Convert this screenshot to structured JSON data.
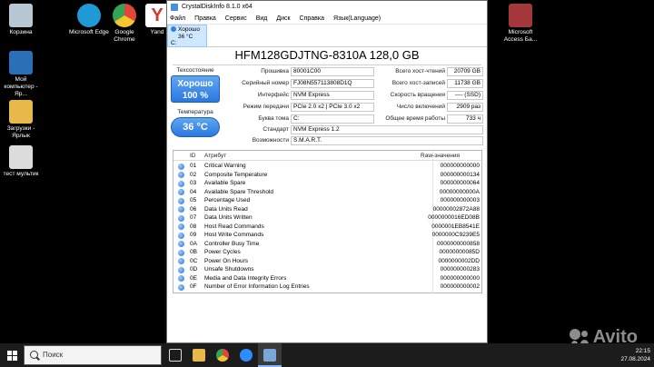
{
  "desktop": {
    "icons": [
      {
        "label": "Корзина",
        "color": "#b9c6d4"
      },
      {
        "label": "Microsoft Edge",
        "color": "#1f9ad6"
      },
      {
        "label": "Google Chrome",
        "color": "#e2463b"
      },
      {
        "label": "Yand",
        "color": "#d23b2c"
      },
      {
        "label": "Microsoft Access Ба...",
        "color": "#a4373a"
      },
      {
        "label": "Мой компьютер - Яр...",
        "color": "#2b6fb6"
      },
      {
        "label": "Загрузки - Ярлык",
        "color": "#e8b84a"
      },
      {
        "label": "тест мультик",
        "color": "#dcdcdc"
      }
    ]
  },
  "app": {
    "title": "CrystalDiskInfo 8.1.0 x64",
    "menu": [
      "Файл",
      "Правка",
      "Сервис",
      "Вид",
      "Диск",
      "Справка",
      "Язык(Language)"
    ],
    "tab": {
      "status": "Хорошо",
      "temp": "36 °C",
      "drive": "C:"
    },
    "model": "HFM128GDJTNG-8310A 128,0 GB",
    "status_label": "Техсостояние",
    "health_word": "Хорошо",
    "health_pct": "100 %",
    "temp_label": "Температура",
    "temp_value": "36 °C",
    "left_fields": [
      {
        "label": "Прошивка",
        "value": "80001C00"
      },
      {
        "label": "Серийный номер",
        "value": "FJ08N557113808D1Q"
      },
      {
        "label": "Интерфейс",
        "value": "NVM Express"
      },
      {
        "label": "Режим передачи",
        "value": "PCIe 2.0 x2 | PCIe 3.0 x2"
      },
      {
        "label": "Буква тома",
        "value": "C:"
      }
    ],
    "right_fields": [
      {
        "label": "Всего хост-чтений",
        "value": "20709 GB"
      },
      {
        "label": "Всего хост-записей",
        "value": "11738 GB"
      },
      {
        "label": "Скорость вращения",
        "value": "---- (SSD)"
      },
      {
        "label": "Число включений",
        "value": "2909 раз"
      },
      {
        "label": "Общее время работы",
        "value": "733 ч"
      }
    ],
    "standard_label": "Стандарт",
    "standard_value": "NVM Express 1.2",
    "features_label": "Возможности",
    "features_value": "S.M.A.R.T.",
    "smart_headers": {
      "id": "ID",
      "attr": "Атрибут",
      "raw": "Raw-значения"
    },
    "smart_rows": [
      {
        "id": "01",
        "attr": "Critical Warning",
        "raw": "000000000000"
      },
      {
        "id": "02",
        "attr": "Composite Temperature",
        "raw": "000000000134"
      },
      {
        "id": "03",
        "attr": "Available Spare",
        "raw": "000000000064"
      },
      {
        "id": "04",
        "attr": "Available Spare Threshold",
        "raw": "00000000000A"
      },
      {
        "id": "05",
        "attr": "Percentage Used",
        "raw": "000000000003"
      },
      {
        "id": "06",
        "attr": "Data Units Read",
        "raw": "00000002872A88"
      },
      {
        "id": "07",
        "attr": "Data Units Written",
        "raw": "0000000016ED08B"
      },
      {
        "id": "08",
        "attr": "Host Read Commands",
        "raw": "0000001EB8541E"
      },
      {
        "id": "09",
        "attr": "Host Write Commands",
        "raw": "0000000C9239E5"
      },
      {
        "id": "0A",
        "attr": "Controller Busy Time",
        "raw": "0000000000858"
      },
      {
        "id": "0B",
        "attr": "Power Cycles",
        "raw": "00000000085D"
      },
      {
        "id": "0C",
        "attr": "Power On Hours",
        "raw": "0000000002DD"
      },
      {
        "id": "0D",
        "attr": "Unsafe Shutdowns",
        "raw": "000000000283"
      },
      {
        "id": "0E",
        "attr": "Media and Data Integrity Errors",
        "raw": "000000000000"
      },
      {
        "id": "0F",
        "attr": "Number of Error Information Log Entries",
        "raw": "000000000002"
      }
    ]
  },
  "taskbar": {
    "search_placeholder": "Поиск",
    "time": "22:15",
    "date": "27.08.2024"
  },
  "watermark": "Avito"
}
